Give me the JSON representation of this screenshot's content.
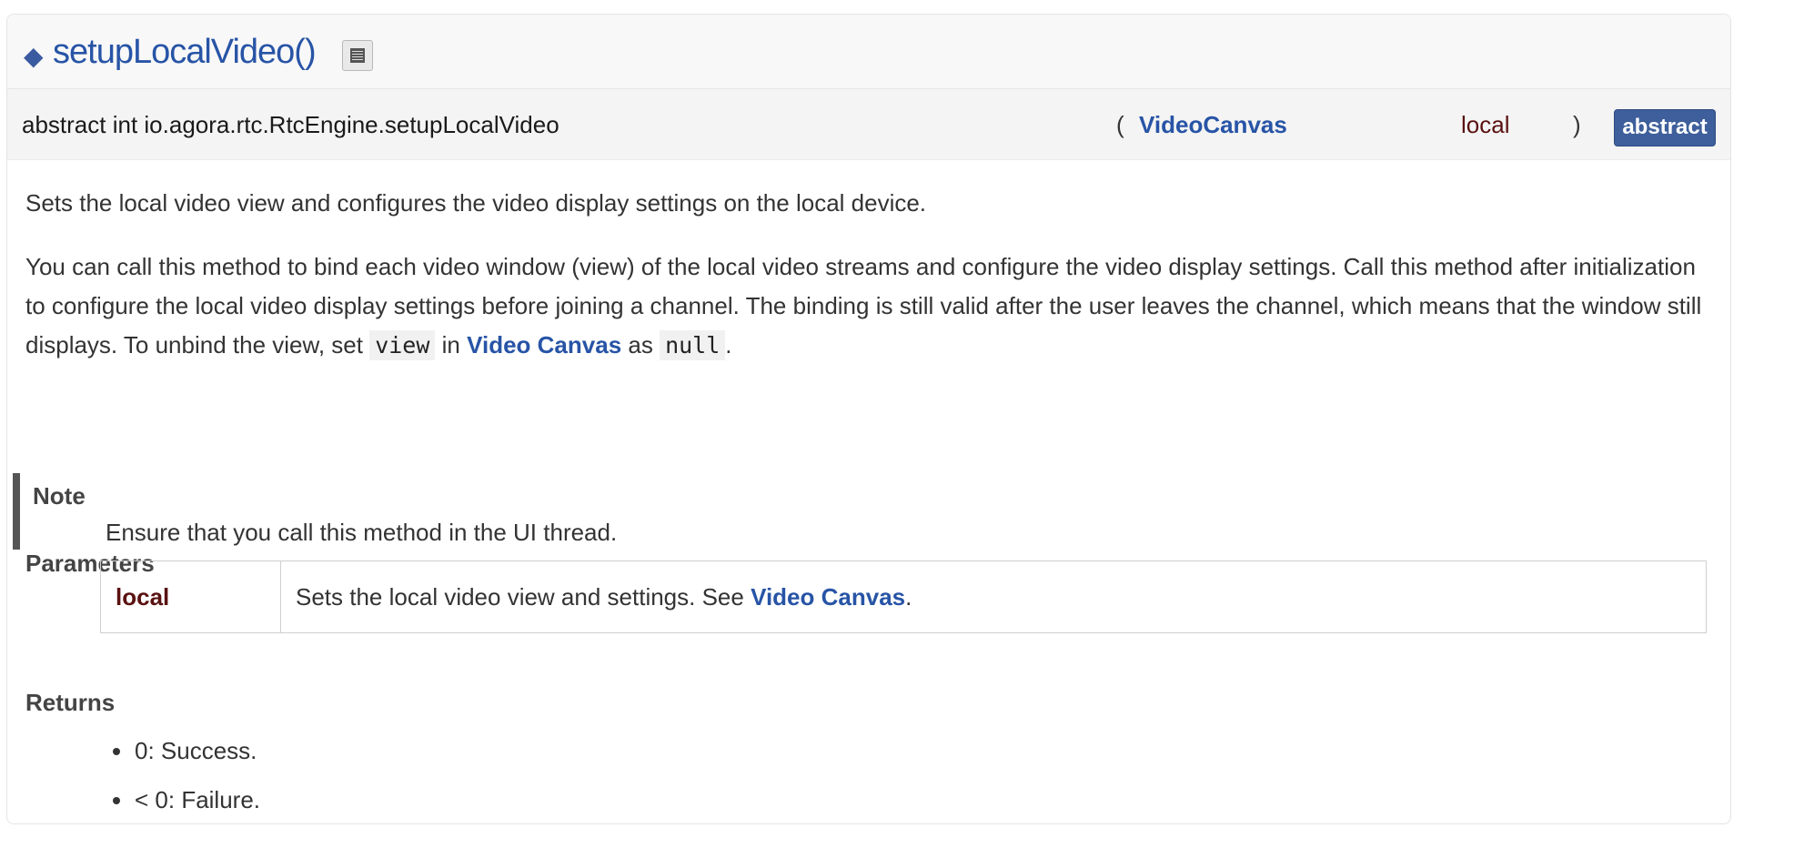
{
  "header": {
    "title": "setupLocalVideo()",
    "diamond_glyph": "◆",
    "doc_icon": "document-icon"
  },
  "prototype": {
    "name": "abstract int io.agora.rtc.RtcEngine.setupLocalVideo",
    "paren_open": "(",
    "param_type": "VideoCanvas",
    "param_name": "local",
    "paren_close": ")",
    "badge": "abstract"
  },
  "doc": {
    "brief": "Sets the local video view and configures the video display settings on the local device.",
    "detail_part1": "You can call this method to bind each video window (view) of the local video streams and configure the video display settings. Call this method after initialization to configure the local video display settings before joining a channel. The binding is still valid after the user leaves the channel, which means that the window still displays. To unbind the view, set ",
    "detail_code1": "view",
    "detail_part2": " in ",
    "detail_link": "Video Canvas",
    "detail_part3": " as ",
    "detail_code2": "null",
    "detail_part4": ".",
    "note_title": "Note",
    "note_text": "Ensure that you call this method in the UI thread.",
    "parameters_title": "Parameters",
    "parameters": [
      {
        "name": "local",
        "desc_prefix": "Sets the local video view and settings. See ",
        "desc_link": "Video Canvas",
        "desc_suffix": "."
      }
    ],
    "returns_title": "Returns",
    "returns": [
      "0: Success.",
      "< 0: Failure."
    ]
  },
  "colors": {
    "link": "#2754a6",
    "param_name": "#5a1111",
    "badge_bg": "#3e5f9b",
    "note_bar": "#555555"
  }
}
